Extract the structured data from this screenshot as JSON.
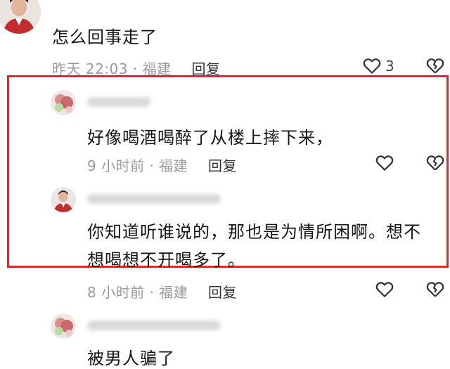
{
  "comments": [
    {
      "text": "怎么回事走了",
      "time": "昨天 22:03",
      "location": "福建",
      "reply_label": "回复",
      "like_count": "3"
    },
    {
      "text": "好像喝酒喝醉了从楼上摔下来，",
      "time": "9 小时前",
      "location": "福建",
      "reply_label": "回复"
    },
    {
      "text_line1": "你知道听谁说的，那也是为情所困啊。想不",
      "text_line2": "想喝想不开喝多了。",
      "time": "8 小时前",
      "location": "福建",
      "reply_label": "回复"
    },
    {
      "text": "被男人骗了"
    }
  ],
  "separator": "·",
  "highlight_color": "#d92b2b"
}
